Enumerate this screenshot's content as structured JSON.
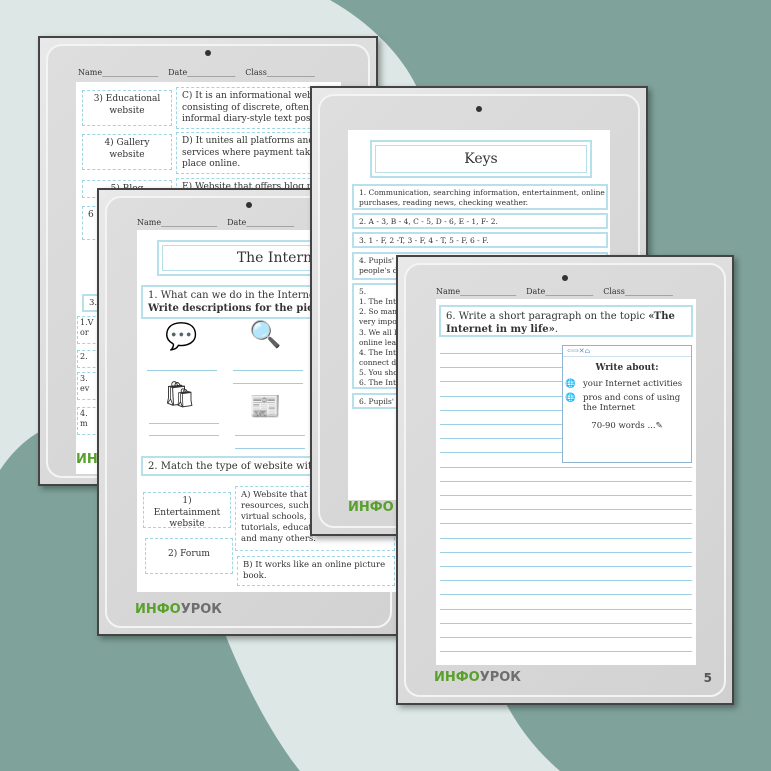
{
  "header_fields": {
    "name": "Name______________",
    "date": "Date____________",
    "class": "Class____________"
  },
  "brand": {
    "logo_a": "ИНФО",
    "logo_b": "УРОК",
    "accent": "#5aa02c",
    "frame_line": "#b7e0ea",
    "bg_teal": "#7fa39b"
  },
  "page1": {
    "rows": [
      {
        "left": "3) Educational website",
        "right": [
          "C) It is an informational webs",
          "consisting of discrete, often",
          "informal diary-style text posts"
        ]
      },
      {
        "left": "4) Gallery website",
        "right": [
          "D) It unites all platforms and",
          "services where payment takes",
          "place online."
        ]
      },
      {
        "left": "5) Blog",
        "right": [
          "E) Website that offers blog po"
        ]
      },
      {
        "left": "6",
        "right": []
      }
    ],
    "section3": "3.",
    "items": [
      "1.V",
      "or",
      "2.",
      "3.",
      "ev",
      "4.",
      "m"
    ],
    "logo": "ИН"
  },
  "page2": {
    "title": "The Internet",
    "q1": "1. What can we do in the Internet?",
    "q1_bold": "Write descriptions for the pictur",
    "icons": [
      "chat-users-icon",
      "web-search-icon",
      "online-shopping-icon",
      "newspaper-icon"
    ],
    "q2": "2. Match the type of website with i",
    "match": [
      {
        "left": "1) Entertainment website",
        "right": [
          "A) Website that p",
          "resources, such a",
          "virtual schools, in",
          "tutorials, educati",
          "and many others."
        ]
      },
      {
        "left": "2) Forum",
        "right": [
          "B) It works like an online picture",
          "book."
        ]
      }
    ]
  },
  "page3": {
    "title": "Keys",
    "keys": [
      [
        "1. Communication, searching information, entertainment, online",
        "purchases, reading news, checking weather."
      ],
      [
        "2. A - 3, B - 4, C - 5, D - 6, E - 1, F- 2."
      ],
      [
        "3. 1 - F, 2 -T, 3 - F, 4 - T, 5 - F, 6 - F."
      ],
      [
        "4. Pupils'",
        "people's d"
      ],
      [
        "5.",
        "1. The Inte",
        "2. So many",
        "very impo",
        "3. We all l",
        "online lea",
        "4. The Inte",
        "connect de",
        "5. You sho",
        "6. The Inte"
      ],
      [
        "6. Pupils'"
      ]
    ],
    "logo": "ИНФО"
  },
  "page4": {
    "task": "6. Write a short paragraph on the topic ",
    "task_bold": "«The Internet in my life»",
    "task_end": ".",
    "browser_toolbar": "⇦⇨✕⌂",
    "write_about": "Write about:",
    "bullets": [
      "your Internet activities",
      "pros and cons of using the Internet"
    ],
    "words": "70-90 words ...✎",
    "page_number": "5"
  }
}
